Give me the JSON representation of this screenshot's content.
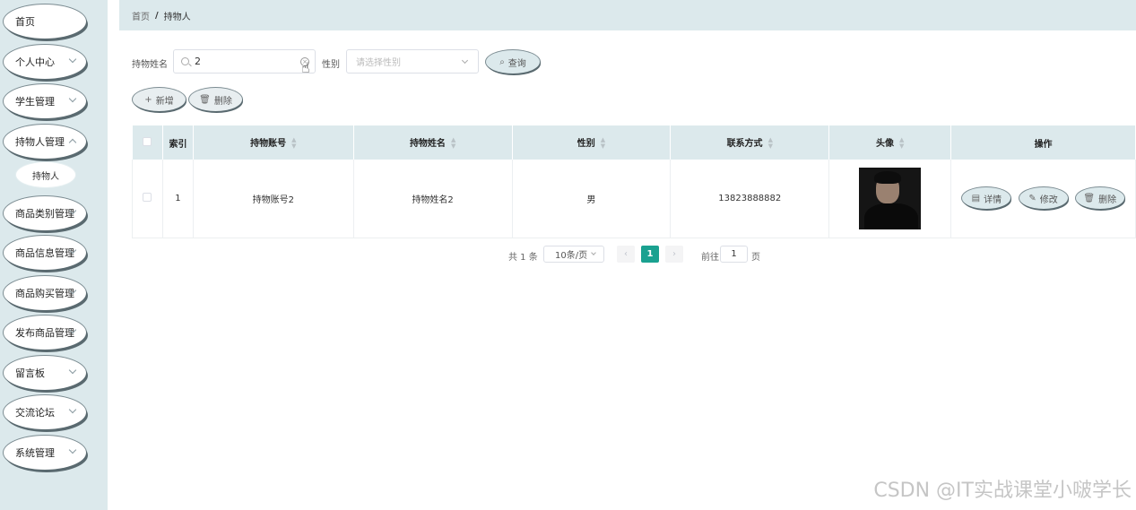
{
  "sidebar": {
    "items": [
      {
        "label": "首页"
      },
      {
        "label": "个人中心"
      },
      {
        "label": "学生管理"
      },
      {
        "label": "持物人管理"
      },
      {
        "label": "商品类别管理"
      },
      {
        "label": "商品信息管理"
      },
      {
        "label": "商品购买管理"
      },
      {
        "label": "发布商品管理"
      },
      {
        "label": "留言板"
      },
      {
        "label": "交流论坛"
      },
      {
        "label": "系统管理"
      }
    ],
    "sub_item": "持物人"
  },
  "breadcrumb": {
    "home": "首页",
    "separator": "/",
    "current": "持物人"
  },
  "filters": {
    "name_label": "持物姓名",
    "name_value": "2",
    "gender_label": "性别",
    "gender_placeholder": "请选择性别",
    "query_button": "查询"
  },
  "toolbar": {
    "add_button": "新增",
    "delete_button": "删除"
  },
  "table": {
    "headers": [
      "索引",
      "持物账号",
      "持物姓名",
      "性别",
      "联系方式",
      "头像",
      "操作"
    ],
    "rows": [
      {
        "index": "1",
        "account": "持物账号2",
        "name": "持物姓名2",
        "gender": "男",
        "phone": "13823888882"
      }
    ],
    "actions": {
      "detail": "详情",
      "edit": "修改",
      "delete": "删除"
    }
  },
  "pagination": {
    "total": "共 1 条",
    "page_size": "10条/页",
    "current_page": "1",
    "goto_label": "前往",
    "goto_value": "1",
    "unit": "页"
  },
  "watermark": "CSDN @IT实战课堂小啵学长",
  "colors": {
    "accent": "#1aa190",
    "panel": "#dce9ec"
  }
}
